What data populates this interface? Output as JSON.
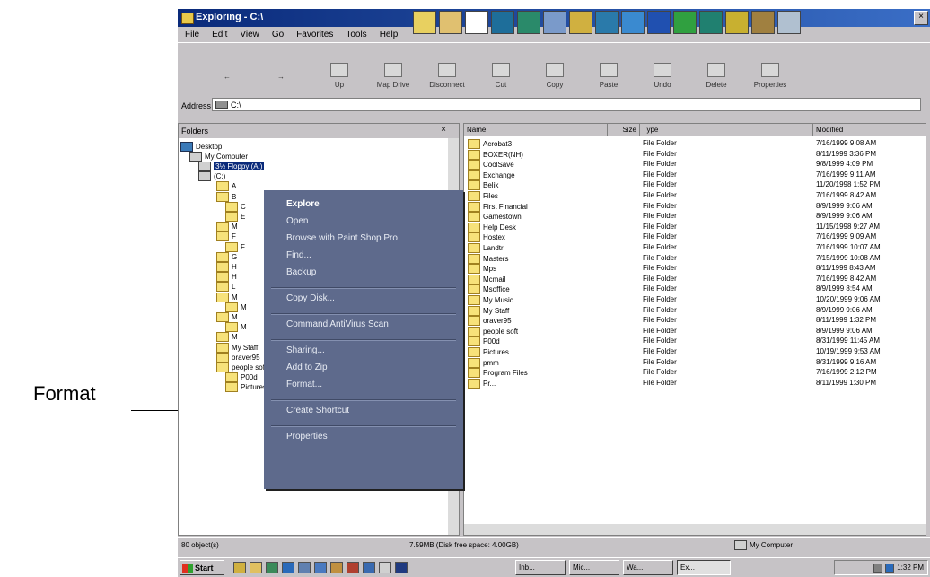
{
  "annotation": {
    "label": "Format"
  },
  "window": {
    "title": "Exploring - C:\\",
    "menu": [
      "File",
      "Edit",
      "View",
      "Go",
      "Favorites",
      "Tools",
      "Help"
    ],
    "toolbar": [
      "",
      "",
      "Up",
      "Map Drive",
      "Disconnect",
      "Cut",
      "Copy",
      "Paste",
      "Undo",
      "Delete",
      "Properties"
    ],
    "address_label": "Address",
    "address_value": "C:\\"
  },
  "folders": {
    "header": "Folders",
    "tree": [
      {
        "label": "Desktop",
        "icon": "desktop"
      },
      {
        "label": "My Computer",
        "icon": "computer"
      },
      {
        "label": "3½ Floppy (A:)",
        "icon": "computer",
        "selected": true
      },
      {
        "label": "(C:)",
        "icon": "computer"
      },
      {
        "label": "A",
        "icon": "folder"
      },
      {
        "label": "B",
        "icon": "folder"
      },
      {
        "label": "C",
        "icon": "folder"
      },
      {
        "label": "E",
        "icon": "folder"
      },
      {
        "label": "M",
        "icon": "folder"
      },
      {
        "label": "F",
        "icon": "folder"
      },
      {
        "label": "F",
        "icon": "folder"
      },
      {
        "label": "G",
        "icon": "folder"
      },
      {
        "label": "H",
        "icon": "folder"
      },
      {
        "label": "H",
        "icon": "folder"
      },
      {
        "label": "L",
        "icon": "folder"
      },
      {
        "label": "M",
        "icon": "folder"
      },
      {
        "label": "M",
        "icon": "folder"
      },
      {
        "label": "M",
        "icon": "folder"
      },
      {
        "label": "M",
        "icon": "folder"
      },
      {
        "label": "M",
        "icon": "folder"
      },
      {
        "label": "My Staff",
        "icon": "folder"
      },
      {
        "label": "oraver95",
        "icon": "folder"
      },
      {
        "label": "people soft",
        "icon": "folder"
      },
      {
        "label": "P00d",
        "icon": "folder"
      },
      {
        "label": "Pictures",
        "icon": "folder"
      }
    ]
  },
  "context_menu": [
    {
      "label": "Explore",
      "bold": true
    },
    {
      "label": "Open"
    },
    {
      "label": "Browse with Paint Shop Pro"
    },
    {
      "label": "Find..."
    },
    {
      "label": "Backup"
    },
    {
      "sep": true
    },
    {
      "label": "Copy Disk..."
    },
    {
      "sep": true
    },
    {
      "label": "Command AntiVirus Scan"
    },
    {
      "sep": true
    },
    {
      "label": "Sharing..."
    },
    {
      "label": "Add to Zip"
    },
    {
      "label": "Format..."
    },
    {
      "sep": true
    },
    {
      "label": "Create Shortcut"
    },
    {
      "sep": true
    },
    {
      "label": "Properties"
    }
  ],
  "files": {
    "columns": [
      "Name",
      "Size",
      "Type",
      "Modified"
    ],
    "rows": [
      [
        "Acrobat3",
        "File Folder",
        "7/16/1999 9:08 AM"
      ],
      [
        "BOXER(NH)",
        "File Folder",
        "8/11/1999 3:36 PM"
      ],
      [
        "CoolSave",
        "File Folder",
        "9/8/1999 4:09 PM"
      ],
      [
        "Exchange",
        "File Folder",
        "7/16/1999 9:11 AM"
      ],
      [
        "Belik",
        "File Folder",
        "11/20/1998 1:52 PM"
      ],
      [
        "Files",
        "File Folder",
        "7/16/1999 8:42 AM"
      ],
      [
        "First Financial",
        "File Folder",
        "8/9/1999 9:06 AM"
      ],
      [
        "Gamestown",
        "File Folder",
        "8/9/1999 9:06 AM"
      ],
      [
        "Help Desk",
        "File Folder",
        "11/15/1998 9:27 AM"
      ],
      [
        "Hostex",
        "File Folder",
        "7/16/1999 9:09 AM"
      ],
      [
        "Landtr",
        "File Folder",
        "7/16/1999 10:07 AM"
      ],
      [
        "Masters",
        "File Folder",
        "7/15/1999 10:08 AM"
      ],
      [
        "Mps",
        "File Folder",
        "8/11/1999 8:43 AM"
      ],
      [
        "Mcmail",
        "File Folder",
        "7/16/1999 8:42 AM"
      ],
      [
        "Msoffice",
        "File Folder",
        "8/9/1999 8:54 AM"
      ],
      [
        "My Music",
        "File Folder",
        "10/20/1999 9:06 AM"
      ],
      [
        "My Staff",
        "File Folder",
        "8/9/1999 9:06 AM"
      ],
      [
        "oraver95",
        "File Folder",
        "8/11/1999 1:32 PM"
      ],
      [
        "people soft",
        "File Folder",
        "8/9/1999 9:06 AM"
      ],
      [
        "P00d",
        "File Folder",
        "8/31/1999 11:45 AM"
      ],
      [
        "Pictures",
        "File Folder",
        "10/19/1999 9:53 AM"
      ],
      [
        "pmm",
        "File Folder",
        "8/31/1999 9:16 AM"
      ],
      [
        "Program Files",
        "File Folder",
        "7/16/1999 2:12 PM"
      ],
      [
        "Pr...",
        "File Folder",
        "8/11/1999 1:30 PM"
      ]
    ]
  },
  "status": {
    "objects": "80 object(s)",
    "space": "7.59MB (Disk free space: 4.00GB)",
    "location": "My Computer"
  },
  "taskbar": {
    "start": "Start",
    "tasks": [
      "Inb...",
      "Mic...",
      "Wa...",
      "Ex..."
    ],
    "clock": "1:32 PM"
  }
}
